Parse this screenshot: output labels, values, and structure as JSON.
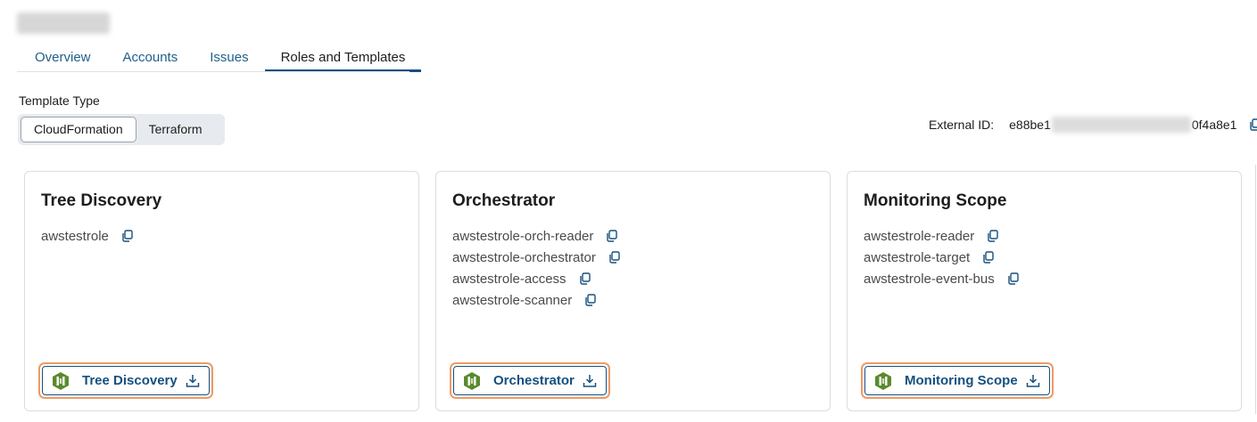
{
  "tabs": [
    {
      "label": "Overview"
    },
    {
      "label": "Accounts"
    },
    {
      "label": "Issues"
    },
    {
      "label": "Roles and Templates"
    }
  ],
  "template_type": {
    "label": "Template Type",
    "options": [
      "CloudFormation",
      "Terraform"
    ],
    "selected": "CloudFormation"
  },
  "external_id": {
    "label": "External ID:",
    "value_prefix": "e88be1",
    "value_suffix": "0f4a8e1"
  },
  "cards": [
    {
      "title": "Tree Discovery",
      "roles": [
        "awstestrole"
      ],
      "button_label": "Tree Discovery"
    },
    {
      "title": "Orchestrator",
      "roles": [
        "awstestrole-orch-reader",
        "awstestrole-orchestrator",
        "awstestrole-access",
        "awstestrole-scanner"
      ],
      "button_label": "Orchestrator"
    },
    {
      "title": "Monitoring Scope",
      "roles": [
        "awstestrole-reader",
        "awstestrole-target",
        "awstestrole-event-bus"
      ],
      "button_label": "Monitoring Scope"
    }
  ],
  "colors": {
    "accent": "#16507e",
    "tab_link": "#1f5f8b",
    "highlight": "#ee9a63",
    "cloudformation": "#5a8a2e"
  },
  "icons": [
    "copy-icon",
    "cloudformation-logo-icon",
    "download-icon"
  ]
}
